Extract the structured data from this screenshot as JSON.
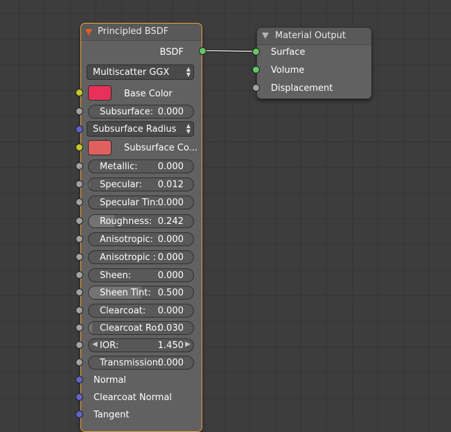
{
  "bsdf_node": {
    "title": "Principled BSDF",
    "output_label": "BSDF",
    "distribution": "Multiscatter GGX",
    "base_color": {
      "label": "Base Color",
      "color": "#e8315a"
    },
    "subsurface": {
      "label": "Subsurface:",
      "value": "0.000",
      "fraction": 0.0
    },
    "subsurface_method": "Subsurface Radius",
    "subsurface_color": {
      "label": "Subsurface Co...",
      "color": "#e06060"
    },
    "params": [
      {
        "label": "Metallic:",
        "value": "0.000",
        "fraction": 0.0
      },
      {
        "label": "Specular:",
        "value": "0.012",
        "fraction": 0.012
      },
      {
        "label": "Specular Tin:",
        "value": "0.000",
        "fraction": 0.0
      },
      {
        "label": "Roughness:",
        "value": "0.242",
        "fraction": 0.242
      },
      {
        "label": "Anisotropic:",
        "value": "0.000",
        "fraction": 0.0
      },
      {
        "label": "Anisotropic :",
        "value": "0.000",
        "fraction": 0.0
      },
      {
        "label": "Sheen:",
        "value": "0.000",
        "fraction": 0.0
      },
      {
        "label": "Sheen Tint:",
        "value": "0.500",
        "fraction": 0.5
      },
      {
        "label": "Clearcoat:",
        "value": "0.000",
        "fraction": 0.0
      },
      {
        "label": "Clearcoat Ro:",
        "value": "0.030",
        "fraction": 0.03
      }
    ],
    "ior": {
      "label": "IOR:",
      "value": "1.450"
    },
    "transmission": {
      "label": "Transmission:",
      "value": "0.000",
      "fraction": 0.0
    },
    "inputs": [
      "Normal",
      "Clearcoat Normal",
      "Tangent"
    ]
  },
  "output_node": {
    "title": "Material Output",
    "inputs": [
      "Surface",
      "Volume",
      "Displacement"
    ]
  },
  "colors": {
    "accent_border": "#f1a33c",
    "socket_color": "#c7c729",
    "socket_float": "#a1a1a1",
    "socket_vector": "#6363c7",
    "socket_shader": "#63c763"
  }
}
